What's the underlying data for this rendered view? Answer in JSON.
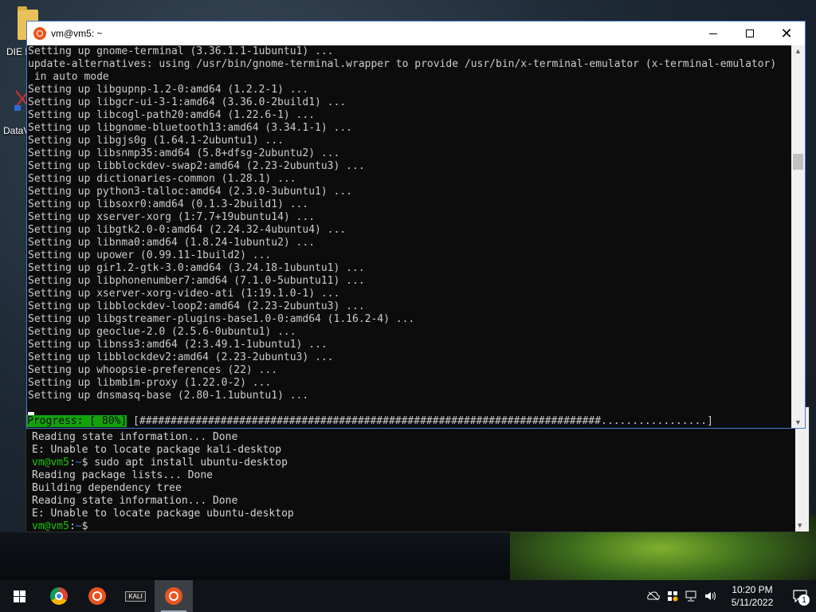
{
  "desktop": {
    "icon1_label": "DIE N",
    "icon2_label": "DataV"
  },
  "main_window": {
    "title": "vm@vm5: ~",
    "lines": [
      "Setting up gnome-terminal (3.36.1.1-1ubuntu1) ...",
      "update-alternatives: using /usr/bin/gnome-terminal.wrapper to provide /usr/bin/x-terminal-emulator (x-terminal-emulator)",
      " in auto mode",
      "Setting up libgupnp-1.2-0:amd64 (1.2.2-1) ...",
      "Setting up libgcr-ui-3-1:amd64 (3.36.0-2build1) ...",
      "Setting up libcogl-path20:amd64 (1.22.6-1) ...",
      "Setting up libgnome-bluetooth13:amd64 (3.34.1-1) ...",
      "Setting up libgjs0g (1.64.1-2ubuntu1) ...",
      "Setting up libsnmp35:amd64 (5.8+dfsg-2ubuntu2) ...",
      "Setting up libblockdev-swap2:amd64 (2.23-2ubuntu3) ...",
      "Setting up dictionaries-common (1.28.1) ...",
      "Setting up python3-talloc:amd64 (2.3.0-3ubuntu1) ...",
      "Setting up libsoxr0:amd64 (0.1.3-2build1) ...",
      "Setting up xserver-xorg (1:7.7+19ubuntu14) ...",
      "Setting up libgtk2.0-0:amd64 (2.24.32-4ubuntu4) ...",
      "Setting up libnma0:amd64 (1.8.24-1ubuntu2) ...",
      "Setting up upower (0.99.11-1build2) ...",
      "Setting up gir1.2-gtk-3.0:amd64 (3.24.18-1ubuntu1) ...",
      "Setting up libphonenumber7:amd64 (7.1.0-5ubuntu11) ...",
      "Setting up xserver-xorg-video-ati (1:19.1.0-1) ...",
      "Setting up libblockdev-loop2:amd64 (2.23-2ubuntu3) ...",
      "Setting up libgstreamer-plugins-base1.0-0:amd64 (1.16.2-4) ...",
      "Setting up geoclue-2.0 (2.5.6-0ubuntu1) ...",
      "Setting up libnss3:amd64 (2:3.49.1-1ubuntu1) ...",
      "Setting up libblockdev2:amd64 (2.23-2ubuntu3) ...",
      "Setting up whoopsie-preferences (22) ...",
      "Setting up libmbim-proxy (1.22.0-2) ...",
      "Setting up dnsmasq-base (2.80-1.1ubuntu1) ..."
    ],
    "progress_label": "Progress: [ 80%]",
    "progress_bar": " [##########################################################################.................]",
    "progress_fraction": 0.8
  },
  "back_window": {
    "lines": [
      {
        "prompt": "",
        "path": "",
        "text": "Reading state information... Done"
      },
      {
        "prompt": "",
        "path": "",
        "text": "E: Unable to locate package kali-desktop"
      },
      {
        "prompt": "vm@vm5",
        "path": "~",
        "text": "$ sudo apt install ubuntu-desktop"
      },
      {
        "prompt": "",
        "path": "",
        "text": "Reading package lists... Done"
      },
      {
        "prompt": "",
        "path": "",
        "text": "Building dependency tree"
      },
      {
        "prompt": "",
        "path": "",
        "text": "Reading state information... Done"
      },
      {
        "prompt": "",
        "path": "",
        "text": "E: Unable to locate package ubuntu-desktop"
      },
      {
        "prompt": "vm@vm5",
        "path": "~",
        "text": "$"
      }
    ]
  },
  "taskbar": {
    "kali_label": "KALI",
    "time": "10:20 PM",
    "date": "5/11/2022",
    "notification_count": "1"
  }
}
